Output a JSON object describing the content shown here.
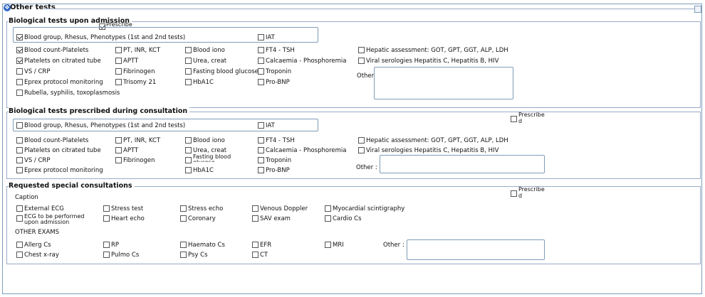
{
  "header": {
    "title": "Other tests"
  },
  "admission": {
    "title": "Biological tests upon admission",
    "prescribe_label": "Prescribe",
    "items": [
      {
        "label": "Blood group, Rhesus, Phenotypes (1st and 2nd tests)",
        "checked": true
      },
      {
        "label": "IAT",
        "checked": false
      },
      {
        "label": "Blood count-Platelets",
        "checked": true
      },
      {
        "label": "PT, INR, KCT",
        "checked": false
      },
      {
        "label": "Blood iono",
        "checked": false
      },
      {
        "label": "FT4 - TSH",
        "checked": false
      },
      {
        "label": "Hepatic assessment: GOT, GPT, GGT, ALP, LDH",
        "checked": false
      },
      {
        "label": "Platelets on citrated tube",
        "checked": true
      },
      {
        "label": "APTT",
        "checked": false
      },
      {
        "label": "Urea, creat",
        "checked": false
      },
      {
        "label": "Calcaemia - Phosphoremia",
        "checked": false
      },
      {
        "label": "Viral serologies Hepatitis C, Hepatitis B, HIV",
        "checked": false
      },
      {
        "label": "VS / CRP",
        "checked": false
      },
      {
        "label": "Fibrinogen",
        "checked": false
      },
      {
        "label": "Fasting blood glucose",
        "checked": false
      },
      {
        "label": "Troponin",
        "checked": false
      },
      {
        "label": "Eprex protocol monitoring",
        "checked": false
      },
      {
        "label": "Trisomy 21",
        "checked": false
      },
      {
        "label": "HbA1C",
        "checked": false
      },
      {
        "label": "Pro-BNP",
        "checked": false
      },
      {
        "label": "Rubella, syphilis, toxoplasmosis",
        "checked": false
      }
    ],
    "other_label": "Other",
    "other_value": ""
  },
  "consultation": {
    "title": "Biological tests prescribed during consultation",
    "prescribe_label_1": "Prescribe",
    "prescribe_label_2": "d",
    "items": [
      {
        "label": "Blood group, Rhesus, Phenotypes (1st and 2nd tests)",
        "checked": false
      },
      {
        "label": "IAT",
        "checked": false
      },
      {
        "label": "Blood count-Platelets",
        "checked": false
      },
      {
        "label": "PT, INR, KCT",
        "checked": false
      },
      {
        "label": "Blood iono",
        "checked": false
      },
      {
        "label": "FT4 - TSH",
        "checked": false
      },
      {
        "label": "Hepatic assessment: GOT, GPT, GGT, ALP, LDH",
        "checked": false
      },
      {
        "label": "Platelets on citrated tube",
        "checked": false
      },
      {
        "label": "APTT",
        "checked": false
      },
      {
        "label": "Urea, creat",
        "checked": false
      },
      {
        "label": "Calcaemia - Phosphoremia",
        "checked": false
      },
      {
        "label": "Viral serologies Hepatitis C, Hepatitis B, HIV",
        "checked": false
      },
      {
        "label": "VS / CRP",
        "checked": false
      },
      {
        "label": "Fibrinogen",
        "checked": false
      },
      {
        "label": "Fasting blood glucose",
        "checked": false
      },
      {
        "label": "Troponin",
        "checked": false
      },
      {
        "label": "Eprex protocol monitoring",
        "checked": false
      },
      {
        "label": "HbA1C",
        "checked": false
      },
      {
        "label": "Pro-BNP",
        "checked": false
      }
    ],
    "other_label": "Other :",
    "other_value": ""
  },
  "special": {
    "title": "Requested special consultations",
    "prescribe_label_1": "Prescribe",
    "prescribe_label_2": "d",
    "caption_label": "Caption",
    "other_exams_label": "OTHER EXAMS",
    "items": [
      {
        "label": "External ECG",
        "checked": false
      },
      {
        "label": "Stress test",
        "checked": false
      },
      {
        "label": "Stress echo",
        "checked": false
      },
      {
        "label": "Venous Doppler",
        "checked": false
      },
      {
        "label": "Myocardial scintigraphy",
        "checked": false
      },
      {
        "label": "ECG to be performed upon admission",
        "checked": false
      },
      {
        "label": "Heart echo",
        "checked": false
      },
      {
        "label": "Coronary",
        "checked": false
      },
      {
        "label": "SAV exam",
        "checked": false
      },
      {
        "label": "Cardio Cs",
        "checked": false
      },
      {
        "label": "Allerg Cs",
        "checked": false
      },
      {
        "label": "RP",
        "checked": false
      },
      {
        "label": "Haemato Cs",
        "checked": false
      },
      {
        "label": "EFR",
        "checked": false
      },
      {
        "label": "MRI",
        "checked": false
      },
      {
        "label": "Chest x-ray",
        "checked": false
      },
      {
        "label": "Pulmo Cs",
        "checked": false
      },
      {
        "label": "Psy Cs",
        "checked": false
      },
      {
        "label": "CT",
        "checked": false
      }
    ],
    "other_label": "Other :",
    "other_value": ""
  }
}
